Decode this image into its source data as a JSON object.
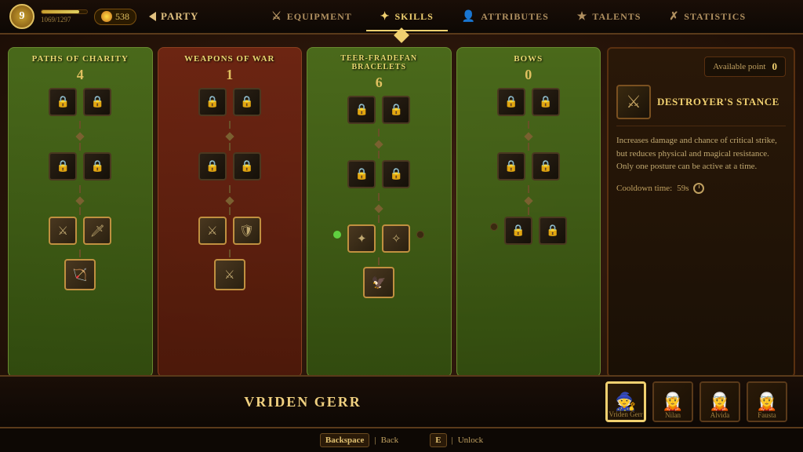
{
  "nav": {
    "level": "9",
    "xp_current": "1069",
    "xp_max": "1297",
    "xp_label": "1069/1297",
    "gold": "538",
    "party_label": "Party",
    "tabs": [
      {
        "id": "equipment",
        "label": "Equipment",
        "icon": "⚔",
        "active": false
      },
      {
        "id": "skills",
        "label": "Skills",
        "icon": "✦",
        "active": true
      },
      {
        "id": "attributes",
        "label": "Attributes",
        "icon": "👤",
        "active": false
      },
      {
        "id": "talents",
        "label": "Talents",
        "icon": "★",
        "active": false
      },
      {
        "id": "statistics",
        "label": "Statistics",
        "icon": "✗",
        "active": false
      }
    ]
  },
  "available_points_label": "Available point",
  "available_points_value": "0",
  "columns": [
    {
      "id": "paths",
      "title": "Paths of Charity",
      "points": "4",
      "color_class": "col-paths"
    },
    {
      "id": "weapons",
      "title": "Weapons of War",
      "points": "1",
      "color_class": "col-weapons"
    },
    {
      "id": "teer",
      "title": "Teer-Fradefan Bracelets",
      "points": "6",
      "color_class": "col-teer"
    },
    {
      "id": "bows",
      "title": "Bows",
      "points": "0",
      "color_class": "col-bows"
    }
  ],
  "info_panel": {
    "title": "Destroyer's Stance",
    "description": "Increases damage and chance of critical strike, but reduces physical and magical resistance. Only one posture can be active at a time.",
    "cooldown_label": "Cooldown time:",
    "cooldown_value": "59s"
  },
  "party_bar": {
    "character_name": "Vriden Gerr",
    "portraits": [
      {
        "name": "Vriden Gerr",
        "active": true,
        "figure": "🧙"
      },
      {
        "name": "Nilan",
        "active": false,
        "figure": "🧝"
      },
      {
        "name": "Alvida",
        "active": false,
        "figure": "🧝"
      },
      {
        "name": "Fausta",
        "active": false,
        "figure": "🧝"
      }
    ]
  },
  "actions": [
    {
      "key": "Backspace",
      "label": "Back"
    },
    {
      "key": "E",
      "label": "Unlock"
    }
  ]
}
